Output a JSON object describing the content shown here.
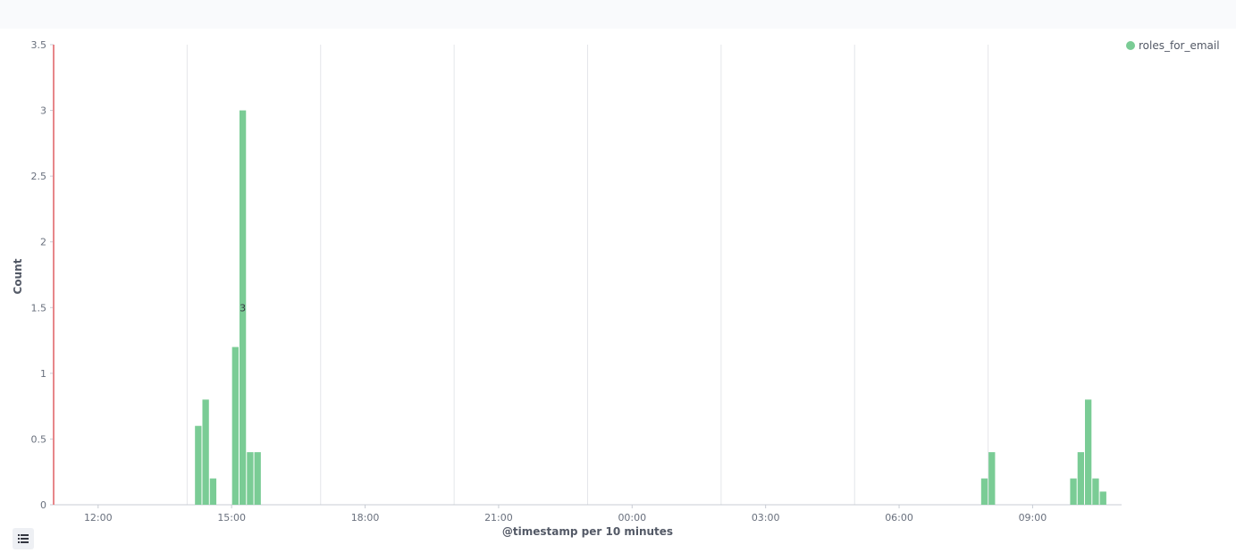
{
  "colors": {
    "series": "#7acc95",
    "grid": "#e4e6ea",
    "axis": "#c8ccd4",
    "marker": "#e7868a",
    "text": "#69707d",
    "label": "#343741"
  },
  "icons": {
    "legend_toggle": "list-icon"
  },
  "chart_data": {
    "type": "bar",
    "xlabel": "@timestamp per 10 minutes",
    "ylabel": "Count",
    "ylim": [
      0,
      3.5
    ],
    "yticks": [
      0,
      0.5,
      1,
      1.5,
      2,
      2.5,
      3,
      3.5
    ],
    "ytick_labels": [
      "0",
      "0.5",
      "1",
      "1.5",
      "2",
      "2.5",
      "3",
      "3.5"
    ],
    "xticks": [
      "12:00",
      "15:00",
      "18:00",
      "21:00",
      "00:00",
      "03:00",
      "06:00",
      "09:00"
    ],
    "xlim_hours": [
      11.0,
      35.0
    ],
    "grid": true,
    "legend_position": "top-right",
    "series": [
      {
        "name": "roles_for_email",
        "bin_minutes": 10,
        "bins": [
          {
            "t": "14:10",
            "value": 0.6
          },
          {
            "t": "14:20",
            "value": 0.8
          },
          {
            "t": "14:30",
            "value": 0.2
          },
          {
            "t": "15:00",
            "value": 1.2
          },
          {
            "t": "15:10",
            "value": 3
          },
          {
            "t": "15:20",
            "value": 0.4
          },
          {
            "t": "15:30",
            "value": 0.4
          },
          {
            "t": "07:50",
            "value": 0.2
          },
          {
            "t": "08:00",
            "value": 0.4
          },
          {
            "t": "09:50",
            "value": 0.2
          },
          {
            "t": "10:00",
            "value": 0.4
          },
          {
            "t": "10:10",
            "value": 0.8
          },
          {
            "t": "10:20",
            "value": 0.2
          },
          {
            "t": "10:30",
            "value": 0.1
          }
        ]
      }
    ],
    "data_labels": [
      {
        "t": "15:10",
        "text": "3"
      }
    ],
    "current_time_marker": "11:00"
  }
}
